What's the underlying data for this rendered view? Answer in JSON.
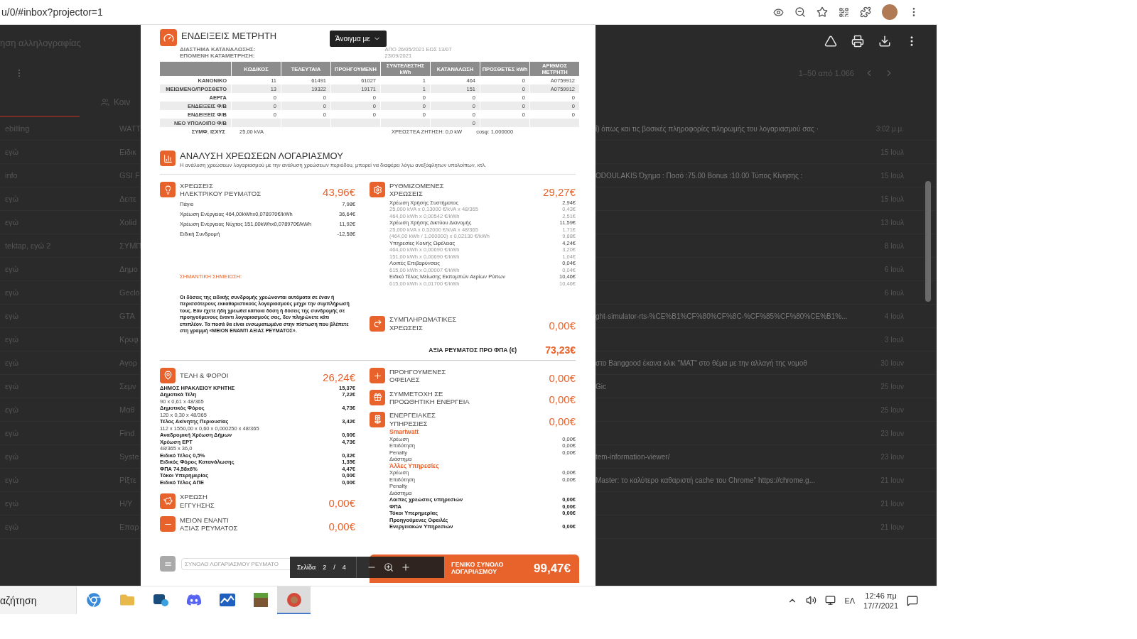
{
  "browser": {
    "url": "u/0/#inbox?projector=1"
  },
  "gmail": {
    "search_hint": "ηση αλληλογραφίας",
    "pager": "1–50 από 1.066",
    "tab": "Κοιν",
    "rows": [
      {
        "sender": "ebilling",
        "subject": "WATT",
        "snippet": "ί) όπως και τις βασικές πληροφορίες πληρωμής του λογαριασμού σας ·",
        "date": "3:02 μ.μ."
      },
      {
        "sender": "εγώ",
        "subject": "Ειδικ",
        "date": "15 Ιουλ"
      },
      {
        "sender": "info",
        "subject": "GSI F",
        "snippet": "ODOULAKIS Όχημα : Ποσό :75.00 Bonus :10.00 Τύπος Κίνησης :",
        "date": "15 Ιουλ"
      },
      {
        "sender": "εγώ",
        "subject": "Δειτε",
        "date": "15 Ιουλ"
      },
      {
        "sender": "εγώ",
        "subject": "Xolid",
        "date": "13 Ιουλ"
      },
      {
        "sender": "tektap, εγώ 2",
        "subject": "ΣΥΜΠ",
        "date": "8 Ιουλ"
      },
      {
        "sender": "εγώ",
        "subject": "Δημο",
        "date": "6 Ιουλ"
      },
      {
        "sender": "εγώ",
        "subject": "Geclo",
        "date": "6 Ιουλ"
      },
      {
        "sender": "εγώ",
        "subject": "GTA",
        "snippet": "ght-simulator-rts-%CE%B1%CF%80%CF%8C-%CF%85%CF%80%CE%B1%...",
        "date": "4 Ιουλ"
      },
      {
        "sender": "εγώ",
        "subject": "Κρυφ",
        "date": "3 Ιουλ"
      },
      {
        "sender": "εγώ",
        "subject": "Αγορ",
        "snippet": "στο Banggood έκανα κλικ \"ΜΑΤ\" στο θέμα με την αλλαγή της νομοθ",
        "date": "30 Ιουν"
      },
      {
        "sender": "εγώ",
        "subject": "Σεμν",
        "snippet": "Gic",
        "date": "25 Ιουν"
      },
      {
        "sender": "εγώ",
        "subject": "Μαθ",
        "date": "25 Ιουν"
      },
      {
        "sender": "εγώ",
        "subject": "Find",
        "date": "23 Ιουν"
      },
      {
        "sender": "εγώ",
        "subject": "Syste",
        "snippet": "tem-information-viewer/",
        "date": "23 Ιουν"
      },
      {
        "sender": "εγώ",
        "subject": "Ρίξτε",
        "snippet": "Master: το καλύτερο καθαριστή cache του Chrome\" https://chrome.g...",
        "date": "21 Ιουν"
      },
      {
        "sender": "εγώ",
        "subject": "H/Y",
        "date": "21 Ιουν"
      },
      {
        "sender": "εγώ",
        "subject": "Επαρ",
        "date": "21 Ιουν"
      }
    ]
  },
  "viewer": {
    "open_with": "Άνοιγμα με",
    "page_label": "Σελίδα",
    "page": "2",
    "separator": "/",
    "pages": "4"
  },
  "meter": {
    "title": "ΕΝΔΕΙΞΕΙΣ ΜΕΤΡΗΤΗ",
    "period_label": "ΔΙΑΣΤΗΜΑ ΚΑΤΑΝΑΛΩΣΗΣ:",
    "period": "ΑΠΟ 26/05/2021 ΕΩΣ 13/07",
    "next_label": "ΕΠΟΜΕΝΗ ΚΑΤΑΜΕΤΡΗΣΗ:",
    "next": "23/09/2021",
    "columns": [
      "ΚΩΔΙΚΟΣ",
      "ΤΕΛΕΥΤΑΙΑ",
      "ΠΡΟΗΓΟΥΜΕΝΗ",
      "ΣΥΝΤΕΛΕΣΤΗΣ kWh",
      "ΚΑΤΑΝΑΛΩΣΗ",
      "ΠΡΟΣΘΕΤΕΣ kWh",
      "ΑΡΙΘΜΟΣ ΜΕΤΡΗΤΗ"
    ],
    "rows": [
      {
        "label": "ΚΑΝΟΝΙΚΟ",
        "cells": [
          "11",
          "61491",
          "61027",
          "1",
          "464",
          "0",
          "A0759912"
        ]
      },
      {
        "label": "ΜΕΙΩΜΕΝΟ/ΠΡΟΣΘΕΤΟ",
        "cells": [
          "13",
          "19322",
          "19171",
          "1",
          "151",
          "0",
          "A0759912"
        ]
      },
      {
        "label": "ΑΕΡΓΑ",
        "cells": [
          "0",
          "0",
          "0",
          "0",
          "0",
          "0",
          "0"
        ]
      },
      {
        "label": "ΕΝΔΕΙΞΕΙΣ Φ/Β",
        "cells": [
          "0",
          "0",
          "0",
          "0",
          "0",
          "0",
          "0"
        ]
      },
      {
        "label": "ΕΝΔΕΙΞΕΙΣ Φ/Β",
        "cells": [
          "0",
          "0",
          "0",
          "0",
          "0",
          "0",
          "0"
        ]
      },
      {
        "label": "ΝΕΟ ΥΠΟΛΟΙΠΟ Φ/Β",
        "cells": [
          null,
          null,
          null,
          null,
          "0",
          null,
          null
        ]
      }
    ],
    "footer": {
      "label": "ΣΥΜΦ. ΙΣΧΥΣ",
      "power": "25,00 kVA",
      "demand": "ΧΡΕΩΣΤΕΑ ΖΗΤΗΣΗ: 0,0 kW",
      "cos": "cosφ: 1,000000"
    }
  },
  "analysis": {
    "title": "ΑΝΑΛΥΣΗ ΧΡΕΩΣΕΩΝ ΛΟΓΑΡΙΑΣΜΟΥ",
    "subtitle": "Η ανάλυση χρεώσεων λογαριασμού με την ανάλυση χρεώσεων περιόδου, μπορεί να διαφέρει λόγω ανεξόφλητων υπολοίπων, κτλ."
  },
  "charges": [
    {
      "title": [
        "ΧΡΕΩΣΕΙΣ",
        "ΗΛΕΚΤΡΙΚΟΥ ΡΕΥΜΑΤΟΣ"
      ],
      "amount": "43,96€",
      "lines": [
        {
          "kind": "item",
          "label": "Πάγιο",
          "value": "7,98€"
        },
        {
          "kind": "item",
          "label": "Χρέωση Ενέργειας 464,00kWhx0,078970€/kWh",
          "value": "36,64€"
        },
        {
          "kind": "item",
          "label": "Χρέωση Ενέργειας Νύχτας 151,00kWhx0,078970€/kWh",
          "value": "11,92€"
        },
        {
          "kind": "item",
          "label": "Ειδική Συνδρομή",
          "value": "-12,58€"
        }
      ]
    },
    {
      "title": [
        "ΡΥΘΜΙΖΟΜΕΝΕΣ",
        "ΧΡΕΩΣΕΙΣ"
      ],
      "amount": "29,27€",
      "lines": [
        {
          "kind": "normal",
          "label": "Χρέωση Χρήσης Συστήματος",
          "value": "2,94€"
        },
        {
          "kind": "light",
          "label": "25,000 kVA x 0,13000 €/kVA x 48/365",
          "value": "0,43€"
        },
        {
          "kind": "light",
          "label": "464,00 kWh x 0,00542 €/kWh",
          "value": "2,51€"
        },
        {
          "kind": "normal",
          "label": "Χρέωση Χρήσης Δικτύου Διανομής",
          "value": "11,59€"
        },
        {
          "kind": "light",
          "label": "25,000 kVA x 0,52000 €/kVA x 48/365",
          "value": "1,71€"
        },
        {
          "kind": "light",
          "label": "(464,00 kWh / 1,000000) x 0,02130 €/kWh",
          "value": "9,88€"
        },
        {
          "kind": "normal",
          "label": "Υπηρεσίες Κοινής Ωφέλειας",
          "value": "4,24€"
        },
        {
          "kind": "light",
          "label": "464,00 kWh x 0,00690 €/kWh",
          "value": "3,20€"
        },
        {
          "kind": "light",
          "label": "151,00 kWh x 0,00690 €/kWh",
          "value": "1,04€"
        },
        {
          "kind": "normal",
          "label": "Λοιπές Επιβαρύνσεις",
          "value": "0,04€"
        },
        {
          "kind": "light",
          "label": "615,00 kWh x 0,00007 €/kWh",
          "value": "0,04€"
        },
        {
          "kind": "normal",
          "label": "Ειδικό Τέλος Μείωσης Εκπομπών Αερίων Ρύπων",
          "value": "10,46€"
        },
        {
          "kind": "light",
          "label": "615,00 kWh x 0,01700 €/kWh",
          "value": "10,46€"
        }
      ]
    },
    {
      "title": [
        "ΣΥΜΠΛΗΡΩΜΑΤΙΚΕΣ",
        "ΧΡΕΩΣΕΙΣ"
      ],
      "amount": "0,00€"
    }
  ],
  "note": {
    "title": "ΣΗΜΑΝΤΙΚΗ ΣΗΜΕΙΩΣΗ:",
    "text": "Οι δόσεις της ειδικής συνδρομής χρεώνονται αυτόματα σε έναν ή περισσότερους εκκαθαριστικούς λογαριασμούς μέχρι την συμπλήρωσή τους. Εάν έχετε ήδη χρεωθεί κάποια δόση ή δόσεις της συνδρομής σε προηγούμενους έναντι λογαριασμούς σας, δεν πληρώνετε κάτι επιπλέον. Τα ποσά θα είναι ενσωματωμένα στην πίστωση που βλέπετε στη γραμμή «ΜΕΙΟΝ ΕΝΑΝΤΙ ΑΞΙΑΣ ΡΕΥΜΑΤΟΣ»."
  },
  "subtotal": {
    "label": "ΑΞΙΑ ΡΕΥΜΑΤΟΣ ΠΡΟ ΦΠΑ (€)",
    "amount": "73,23€"
  },
  "taxes": [
    {
      "title": [
        "ΤΕΛΗ & ΦΟΡΟΙ"
      ],
      "amount": "26,24€",
      "lines": [
        {
          "kind": "bold",
          "label": "ΔΗΜΟΣ ΗΡΑΚΛΕΙΟΥ ΚΡΗΤΗΣ",
          "value": "15,37€"
        },
        {
          "kind": "bold",
          "label": "Δημοτικά Τέλη",
          "value": "7,22€"
        },
        {
          "kind": "normal",
          "label": "90 x 0,61 x 48/365"
        },
        {
          "kind": "bold",
          "label": "Δημοτικός Φόρος",
          "value": "4,73€"
        },
        {
          "kind": "normal",
          "label": "120 x 0,30 x 48/365"
        },
        {
          "kind": "bold",
          "label": "Τέλος Ακίνητης Περιουσίας",
          "value": "3,42€"
        },
        {
          "kind": "normal",
          "label": "112 x 1550,00 x 0,60 x 0,000250 x 48/365"
        },
        {
          "kind": "bold",
          "label": "Αναδρομική Χρέωση Δήμων",
          "value": "0,00€"
        },
        {
          "kind": "bold",
          "label": "Χρέωση ΕΡΤ",
          "value": "4,73€"
        },
        {
          "kind": "normal",
          "label": "48/365 x 36,0"
        },
        {
          "kind": "bold",
          "label": "Ειδικό Τέλος 0,5%",
          "value": "0,32€"
        },
        {
          "kind": "bold",
          "label": "Ειδικός Φόρος Κατανάλωσης",
          "value": "1,35€"
        },
        {
          "kind": "bold",
          "label": "ΦΠΑ 74,58x6%",
          "value": "4,47€"
        },
        {
          "kind": "bold",
          "label": "Τόκοι Υπερημερίας",
          "value": "0,00€"
        },
        {
          "kind": "bold",
          "label": "Ειδικό Τέλος ΑΠΕ",
          "value": "0,00€"
        }
      ]
    },
    {
      "title": [
        "ΧΡΕΩΣΗ",
        "ΕΓΓΥΗΣΗΣ"
      ],
      "amount": "0,00€"
    },
    {
      "title": [
        "ΜΕΙΟΝ ΕΝΑΝΤΙ",
        "ΑΞΙΑΣ ΡΕΥΜΑΤΟΣ"
      ],
      "amount": "0,00€"
    }
  ],
  "others": [
    {
      "title": [
        "ΠΡΟΗΓΟΥΜΕΝΕΣ",
        "ΟΦΕΙΛΕΣ"
      ],
      "amount": "0,00€"
    },
    {
      "title": [
        "ΣΥΜΜΕΤΟΧΗ ΣΕ",
        "ΠΡΟΩΘΗΤΙΚΗ ΕΝΕΡΓΕΙΑ"
      ],
      "amount": "0,00€"
    },
    {
      "title": [
        "ΕΝΕΡΓΕΙΑΚΕΣ",
        "ΥΠΗΡΕΣΙΕΣ"
      ],
      "amount": "0,00€",
      "lines": [
        {
          "kind": "heading",
          "label": "Smartwatt"
        },
        {
          "kind": "normal",
          "label": "Χρέωση",
          "value": "0,00€"
        },
        {
          "kind": "normal",
          "label": "Επιδότηση",
          "value": "0,00€"
        },
        {
          "kind": "normal",
          "label": "Penalty",
          "value": "0,00€"
        },
        {
          "kind": "normal",
          "label": "Διάστημα"
        },
        {
          "kind": "heading",
          "label": "Άλλες Υπηρεσίες"
        },
        {
          "kind": "normal",
          "label": "Χρέωση",
          "value": "0,00€"
        },
        {
          "kind": "normal",
          "label": "Επιδότηση",
          "value": "0,00€"
        },
        {
          "kind": "normal",
          "label": "Penalty"
        },
        {
          "kind": "normal",
          "label": "Διάστημα"
        },
        {
          "kind": "bold",
          "label": "Λοιπες χρεώσεις υπηρεσιών",
          "value": "0,00€"
        },
        {
          "kind": "bold",
          "label": "ΦΠΑ",
          "value": "0,00€"
        },
        {
          "kind": "bold",
          "label": "Τόκοι Υπερημερίας",
          "value": "0,00€"
        },
        {
          "kind": "bold",
          "label": "Προηγούμενες Οφειλές"
        },
        {
          "kind": "bold",
          "label": "Ενεργειακών Υπηρεσιών",
          "value": "0,00€"
        }
      ]
    }
  ],
  "totals": {
    "account_label": "ΣΥΝΟΛΟ ΛΟΓΑΡΙΑΣΜΟΥ ΡΕΥΜΑΤΟ",
    "grand_label": [
      "ΓΕΝΙΚΟ ΣΥΝΟΛΟ",
      "ΛΟΓΑΡΙΑΣΜΟΥ"
    ],
    "grand_amount": "99,47€"
  },
  "taskbar": {
    "search": "αζήτηση",
    "apps": [
      {
        "selected": false
      },
      {
        "selected": false
      },
      {
        "selected": false
      },
      {
        "selected": false
      },
      {
        "selected": false
      },
      {
        "selected": false
      },
      {
        "selected": true
      }
    ],
    "language": "ΕΛ",
    "time": "12:46 πμ",
    "date": "17/7/2021"
  }
}
